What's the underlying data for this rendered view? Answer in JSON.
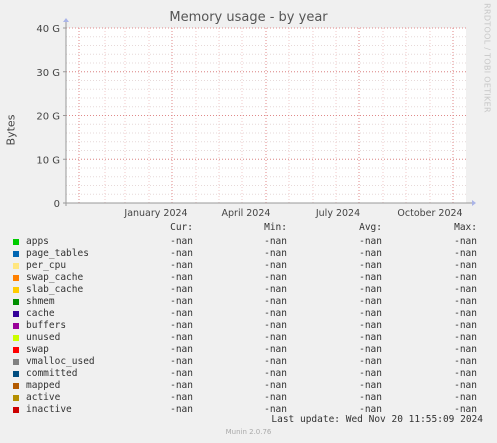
{
  "chart_data": {
    "type": "line",
    "title": "Memory usage - by year",
    "ylabel": "Bytes",
    "yticks": [
      "0",
      "10 G",
      "20 G",
      "30 G",
      "40 G"
    ],
    "ylim": [
      0,
      40
    ],
    "xticks": [
      "January 2024",
      "April 2024",
      "July 2024",
      "October 2024"
    ],
    "grid": true,
    "series": []
  },
  "watermark": "RRDTOOL / TOBI OETIKER",
  "legend": {
    "headers": [
      "Cur:",
      "Min:",
      "Avg:",
      "Max:"
    ],
    "items": [
      {
        "name": "apps",
        "color": "#00cc00",
        "cur": "-nan",
        "min": "-nan",
        "avg": "-nan",
        "max": "-nan"
      },
      {
        "name": "page_tables",
        "color": "#0066b3",
        "cur": "-nan",
        "min": "-nan",
        "avg": "-nan",
        "max": "-nan"
      },
      {
        "name": "per_cpu",
        "color": "#ffe680",
        "cur": "-nan",
        "min": "-nan",
        "avg": "-nan",
        "max": "-nan"
      },
      {
        "name": "swap_cache",
        "color": "#ff8000",
        "cur": "-nan",
        "min": "-nan",
        "avg": "-nan",
        "max": "-nan"
      },
      {
        "name": "slab_cache",
        "color": "#ffcc00",
        "cur": "-nan",
        "min": "-nan",
        "avg": "-nan",
        "max": "-nan"
      },
      {
        "name": "shmem",
        "color": "#008f00",
        "cur": "-nan",
        "min": "-nan",
        "avg": "-nan",
        "max": "-nan"
      },
      {
        "name": "cache",
        "color": "#330099",
        "cur": "-nan",
        "min": "-nan",
        "avg": "-nan",
        "max": "-nan"
      },
      {
        "name": "buffers",
        "color": "#990099",
        "cur": "-nan",
        "min": "-nan",
        "avg": "-nan",
        "max": "-nan"
      },
      {
        "name": "unused",
        "color": "#ccff00",
        "cur": "-nan",
        "min": "-nan",
        "avg": "-nan",
        "max": "-nan"
      },
      {
        "name": "swap",
        "color": "#ff0000",
        "cur": "-nan",
        "min": "-nan",
        "avg": "-nan",
        "max": "-nan"
      },
      {
        "name": "vmalloc_used",
        "color": "#808080",
        "cur": "-nan",
        "min": "-nan",
        "avg": "-nan",
        "max": "-nan"
      },
      {
        "name": "committed",
        "color": "#004d80",
        "cur": "-nan",
        "min": "-nan",
        "avg": "-nan",
        "max": "-nan"
      },
      {
        "name": "mapped",
        "color": "#b35a00",
        "cur": "-nan",
        "min": "-nan",
        "avg": "-nan",
        "max": "-nan"
      },
      {
        "name": "active",
        "color": "#b38f00",
        "cur": "-nan",
        "min": "-nan",
        "avg": "-nan",
        "max": "-nan"
      },
      {
        "name": "inactive",
        "color": "#cc0000",
        "cur": "-nan",
        "min": "-nan",
        "avg": "-nan",
        "max": "-nan"
      }
    ]
  },
  "last_update": "Last update: Wed Nov 20 11:55:09 2024",
  "footer": "Munin 2.0.76"
}
